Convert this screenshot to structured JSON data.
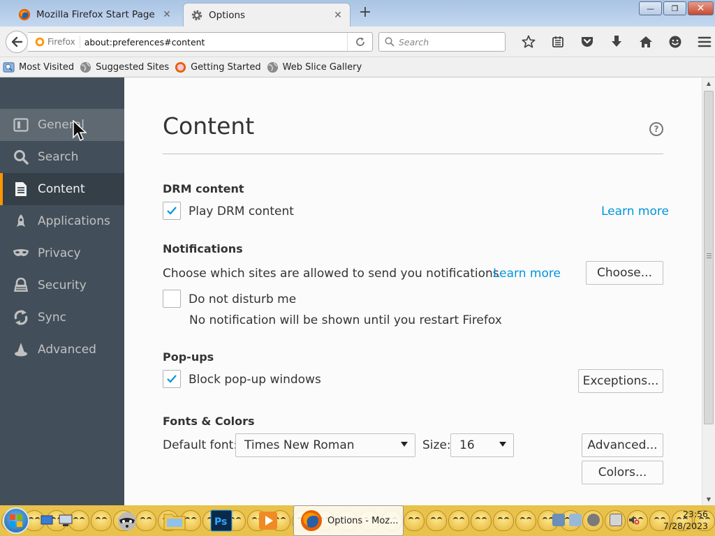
{
  "window": {
    "tabs": [
      {
        "title": "Mozilla Firefox Start Page",
        "active": false
      },
      {
        "title": "Options",
        "active": true
      }
    ],
    "new_tab_label": "+",
    "controls": {
      "minimize": "—",
      "maximize": "❐",
      "close": "✕"
    }
  },
  "navbar": {
    "identity_label": "Firefox",
    "url": "about:preferences#content",
    "search_placeholder": "Search",
    "icons": [
      "bookmark-star-icon",
      "reading-list-icon",
      "pocket-icon",
      "downloads-icon",
      "home-icon",
      "hello-icon",
      "menu-icon"
    ]
  },
  "bookmarks": [
    {
      "label": "Most Visited",
      "icon": "most-visited-icon"
    },
    {
      "label": "Suggested Sites",
      "icon": "globe-icon"
    },
    {
      "label": "Getting Started",
      "icon": "firefox-icon"
    },
    {
      "label": "Web Slice Gallery",
      "icon": "globe-icon"
    }
  ],
  "sidebar": {
    "items": [
      {
        "label": "General",
        "icon": "general-icon",
        "state": "hover"
      },
      {
        "label": "Search",
        "icon": "search-icon",
        "state": "normal"
      },
      {
        "label": "Content",
        "icon": "content-icon",
        "state": "selected"
      },
      {
        "label": "Applications",
        "icon": "applications-icon",
        "state": "normal"
      },
      {
        "label": "Privacy",
        "icon": "privacy-mask-icon",
        "state": "normal"
      },
      {
        "label": "Security",
        "icon": "security-icon",
        "state": "normal"
      },
      {
        "label": "Sync",
        "icon": "sync-icon",
        "state": "normal"
      },
      {
        "label": "Advanced",
        "icon": "advanced-wizard-icon",
        "state": "normal"
      }
    ]
  },
  "content": {
    "title": "Content",
    "help_label": "?",
    "drm": {
      "heading": "DRM content",
      "checkbox_label": "Play DRM content",
      "checked": true,
      "learn_more": "Learn more"
    },
    "notifications": {
      "heading": "Notifications",
      "description": "Choose which sites are allowed to send you notifications",
      "learn_more": "Learn more",
      "choose_button": "Choose...",
      "dnd_label": "Do not disturb me",
      "dnd_checked": false,
      "dnd_note": "No notification will be shown until you restart Firefox"
    },
    "popups": {
      "heading": "Pop-ups",
      "checkbox_label": "Block pop-up windows",
      "checked": true,
      "exceptions_button": "Exceptions..."
    },
    "fonts": {
      "heading": "Fonts & Colors",
      "default_font_label": "Default font:",
      "default_font_value": "Times New Roman",
      "size_label": "Size:",
      "size_value": "16",
      "advanced_button": "Advanced...",
      "colors_button": "Colors..."
    }
  },
  "taskbar": {
    "task_label": "Options - Moz...",
    "time": "23:56",
    "date": "7/28/2023"
  },
  "colors": {
    "sidebar_bg": "#424f5a",
    "sidebar_selected_accent": "#ff9500",
    "link": "#0095dd",
    "checkmark": "#0095dd"
  }
}
